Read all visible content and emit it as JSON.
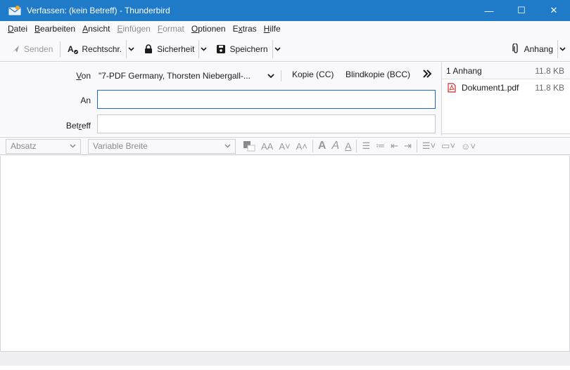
{
  "window": {
    "title": "Verfassen: (kein Betreff) - Thunderbird",
    "minimize": "—",
    "maximize": "☐",
    "close": "✕",
    "accent": "#1f7ac8"
  },
  "menu": {
    "datei": {
      "u": "D",
      "rest": "atei"
    },
    "bearbeiten": {
      "u": "B",
      "rest": "earbeiten"
    },
    "ansicht": {
      "u": "A",
      "rest": "nsicht"
    },
    "einfuegen": {
      "u": "E",
      "rest": "infügen"
    },
    "format": {
      "u": "F",
      "rest": "ormat"
    },
    "optionen": {
      "u": "O",
      "rest": "ptionen"
    },
    "extras": {
      "pre": "E",
      "u": "x",
      "rest": "tras"
    },
    "hilfe": {
      "u": "H",
      "rest": "ilfe"
    }
  },
  "toolbar": {
    "send": "Senden",
    "spelling": "Rechtschr.",
    "security": "Sicherheit",
    "save": "Speichern",
    "attach": "Anhang"
  },
  "header": {
    "from_label": {
      "u": "V",
      "rest": "on"
    },
    "from_value": "\"7-PDF Germany, Thorsten Niebergall-...",
    "cc": "Kopie (CC)",
    "bcc": "Blindkopie (BCC)",
    "to_label": "An",
    "to_value": "",
    "subject_label": {
      "pre": "Bet",
      "u": "r",
      "rest": "eff"
    },
    "subject_value": ""
  },
  "attachments": {
    "count_label": {
      "pre": "1 Anhan",
      "u": "g",
      "rest": ""
    },
    "total_size": "11.8 KB",
    "items": [
      {
        "name": "Dokument1.pdf",
        "size": "11.8 KB",
        "icon": "pdf-icon"
      }
    ]
  },
  "format": {
    "paragraph": "Absatz",
    "font": "Variable Breite"
  }
}
